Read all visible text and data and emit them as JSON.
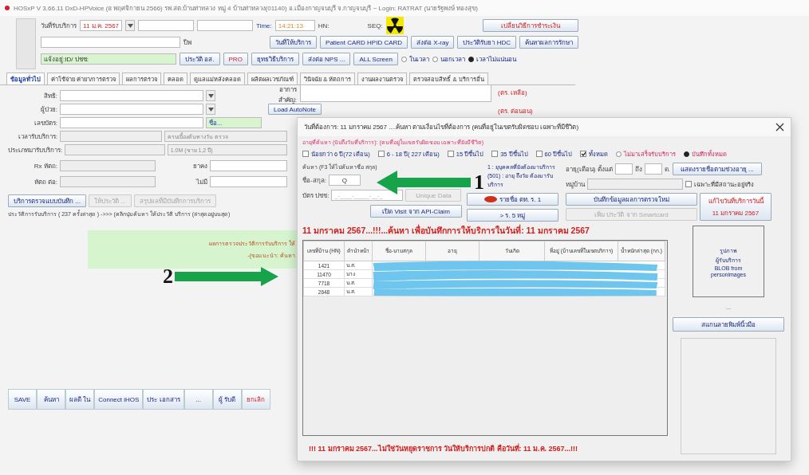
{
  "window": {
    "title": "HOSxP V 3.66.11 DxD-HPVoice (8 พฤศจิกายน 2566) รพ.สต.บ้านท่าหลวง หมู่ 4 บ้านท่าหลวง(01140) อ.เมืองกาญจนบุรี จ.กาญจนบุรี ~ Login: RATRAT (นายรัฐพงษ์ ทองสุข)"
  },
  "header": {
    "date_label": "วันที่รับบริการ",
    "date_value": "11 ม.ค. 2567",
    "time_label": "Time:",
    "time_value": "14:21:13",
    "hn_label": "HN:",
    "seq_label": "SEQ:",
    "unit_label": "ปีพ",
    "register_label": "แจ้งอยู่:",
    "register_value": "ID/ ปชช:",
    "buttons_row1": [
      {
        "label": "เปลี่ยนวิธีการชำระเงิน",
        "red": true
      }
    ],
    "buttons_row2": [
      {
        "label": "วันที่ให้บริการ",
        "red": false
      },
      {
        "label": "Patient CARD HPID CARD",
        "red": false
      },
      {
        "label": "ส่งต่อ X-ray",
        "red": false
      },
      {
        "label": "ประวัติรับยา HDC",
        "red": false
      },
      {
        "label": "ค้นหาผลการรักษา",
        "red": false
      }
    ],
    "buttons_row3": [
      {
        "label": "ประวัติ อส.",
        "red": false
      },
      {
        "label": "PRO",
        "red": true
      },
      {
        "label": "ยุทธวิธีบริการ",
        "red": false
      },
      {
        "label": "ส่งต่อ NPS ...",
        "red": false
      },
      {
        "label": "ALL Screen",
        "red": false
      }
    ],
    "radios": [
      {
        "label": "ในเวลา",
        "selected": false
      },
      {
        "label": "นอกเวลา",
        "selected": false
      },
      {
        "label": "เวลาไม่แน่นอน",
        "selected": true
      }
    ]
  },
  "tabs": [
    {
      "label": "ข้อมูลทั่วไป",
      "selected": true
    },
    {
      "label": "ค่าใช้จ่าย ค่ายา/การตรวจ",
      "selected": false
    },
    {
      "label": "ผลการตรวจ",
      "selected": false
    },
    {
      "label": "คลอด",
      "selected": false
    },
    {
      "label": "ดูแลแม่หลังคลอด",
      "selected": false
    },
    {
      "label": "ผลิตผลเวชภัณฑ์",
      "selected": false
    },
    {
      "label": "วินิจฉัย & หัตถการ",
      "selected": false
    },
    {
      "label": "งานผลงานตรวจ",
      "selected": false
    },
    {
      "label": "ตรวจสอบสิทธิ์ & บริการอื่น",
      "selected": false
    }
  ],
  "form": {
    "rows": [
      {
        "label": "สิทธิ:",
        "hint": ""
      },
      {
        "label": "ผู้ป่วย:",
        "hint": ""
      },
      {
        "label": "เลขบัตร:",
        "hint": "ชื่อ..."
      }
    ],
    "selects": [
      {
        "label": "เวลารับบริการ:",
        "note": "ครบเบื้องต้นทางวัน ตรวจ"
      },
      {
        "label": "ประเภทมารับบริการ:",
        "note": "1.0M (ชาย 1,2 ปี)"
      }
    ],
    "right_label": "อาการสำคัญ:",
    "autonote_button": "Load AutoNote",
    "labels_right": [
      "(ตร. เหลือ)",
      "(ตร. ต่อนอน)"
    ],
    "rx": [
      {
        "label": "Rx หัตถ:",
        "side": "ยาคง"
      },
      {
        "label": "หัตถ ต่อ:",
        "side": "ไม่มี"
      }
    ],
    "action_buttons": [
      {
        "label": "บริการตรวจแบบบันทึก ...",
        "disabled": false
      },
      {
        "label": "ให้ประวัติ ...",
        "disabled": true
      },
      {
        "label": "สรุปผลที่มีบันทึกการบริการ",
        "disabled": true
      }
    ],
    "history_text": "ประวัติการรับบริการ ( 237 ครั้งล่าสุด ) ->>> (คลิกปุ่มค้นหา ให้ประวัติ บริการ (ล่าสุดอยู่บนสุด)",
    "green_lines": [
      "ผลการตรวจประวัติการรับบริการ ให้",
      "-(ขอแนะนำ: ค้นหา"
    ]
  },
  "toolbar": [
    {
      "label": "SAVE",
      "red": false
    },
    {
      "label": "ค้นหา",
      "red": false
    },
    {
      "label": "ผลดี ใน",
      "red": false
    },
    {
      "label": "Connect iHOS",
      "red": false
    },
    {
      "label": "ประ เอกสาร",
      "red": false
    },
    {
      "label": "...",
      "red": false
    },
    {
      "label": "ผู้ รับดี",
      "red": false
    },
    {
      "label": "ยกเลิก",
      "red": true
    }
  ],
  "dialog": {
    "title": "วันที่ต้องการ: 11 มกราคม 2567 ....ค้นหา ตามเงื่อนไขที่ต้องการ (คนที่อยู่ในเขตรับผิดชอบ เฉพาะที่มีชีวิต)",
    "filter_label": "อายุที่ค้นหา (นับถึงวันที่บริการ): (คนที่อยู่ในเขตรับผิดชอบ เฉพาะที่ยังมีชีวิต)",
    "filters": [
      {
        "kind": "check",
        "label": "น้อยกว่า 6 ปี(72 เดือน)",
        "checked": false
      },
      {
        "kind": "check",
        "label": "6 - 18 ปี( 227 เดือน)",
        "checked": false
      },
      {
        "kind": "check",
        "label": "15 ปีขึ้นไป",
        "checked": false
      },
      {
        "kind": "check",
        "label": "35 ปีขึ้นไป",
        "checked": false
      },
      {
        "kind": "check",
        "label": "60 ปีขึ้นไป",
        "checked": false
      },
      {
        "kind": "check",
        "label": "ทั้งหมด",
        "checked": true
      },
      {
        "kind": "radio",
        "label": "ไม่มาเสร็จรับบริการ",
        "checked": false
      },
      {
        "kind": "radio",
        "label": "บันทึกทั้งหมด",
        "checked": true
      }
    ],
    "search_label": "ค้นหา (F3 ให้ไปค้นหาชื่อ สกุล)",
    "name_label": "ชื่อ-สกุล:",
    "name_value": "Q",
    "cid_label": "บัตร ปชช:",
    "cid_value": "_-____-_____-__-_",
    "unique_button": "Unique Data",
    "api_button": "เปิด Visit จาก API-Claim",
    "note": "1 : ยุบุคคลที่ยังต้องมาบริการ (501) : อายุ ถึงวัย ต้องมารับบริการ",
    "age_label": "อายุ(เดือน) ตั้งแต่",
    "age_to": "ถึง",
    "age_unit": "ด.",
    "age_button": "แสดงรายชื่อตามช่วงอายุ ...",
    "village_label": "หมู่บ้าน",
    "village_check": {
      "label": "เฉพาะที่มีสถานะอยู่จริง",
      "checked": false
    },
    "list_button": "รายชื่อ ตท. ร. 1",
    "group_button": "> ร. 5 หมู่",
    "new_button": "บันทึกข้อมูลผลการตรวจใหม่",
    "smartcard_button": "เพิ่ม ประวัติ จาก Smartcard",
    "today_button": [
      "แก้ไขวันที่บริการวันนี้",
      "11 มกราคม 2567"
    ],
    "heading": "11 มกราคม 2567...!!!...ค้นหา เพื่อบันทึกการให้บริการในวันที่: 11 มกราคม 2567",
    "table": {
      "columns": [
        "เลขที่บ้าน (HN)",
        "คำนำหน้า",
        "ชื่อ-นามสกุล",
        "อายุ",
        "วันเกิด",
        "ที่อยู่ (บ้านเลขที่ในเขตบริการ)",
        "น้ำหนักล่าสุด (กก.)"
      ],
      "rows": [
        {
          "hn": "1421",
          "prefix": "น.ส."
        },
        {
          "hn": "11470",
          "prefix": "นาง"
        },
        {
          "hn": "7718",
          "prefix": "น.ส."
        },
        {
          "hn": "2648",
          "prefix": "น.ส."
        }
      ]
    },
    "photo_lines": [
      "รูปภาพ",
      "ผู้รับบริการ",
      "BLOB from",
      "personimages"
    ],
    "photo_dash": "...",
    "scan_button": "สแกนลายพิมพ์นิ้วมือ",
    "footer": "!!! 11 มกราคม 2567...ไม่ใช่วันหยุดราชการ วันให้บริการปกติ คือวันที่: 11 ม.ค. 2567...!!!"
  },
  "annotations": [
    {
      "number": "1"
    },
    {
      "number": "2"
    }
  ]
}
